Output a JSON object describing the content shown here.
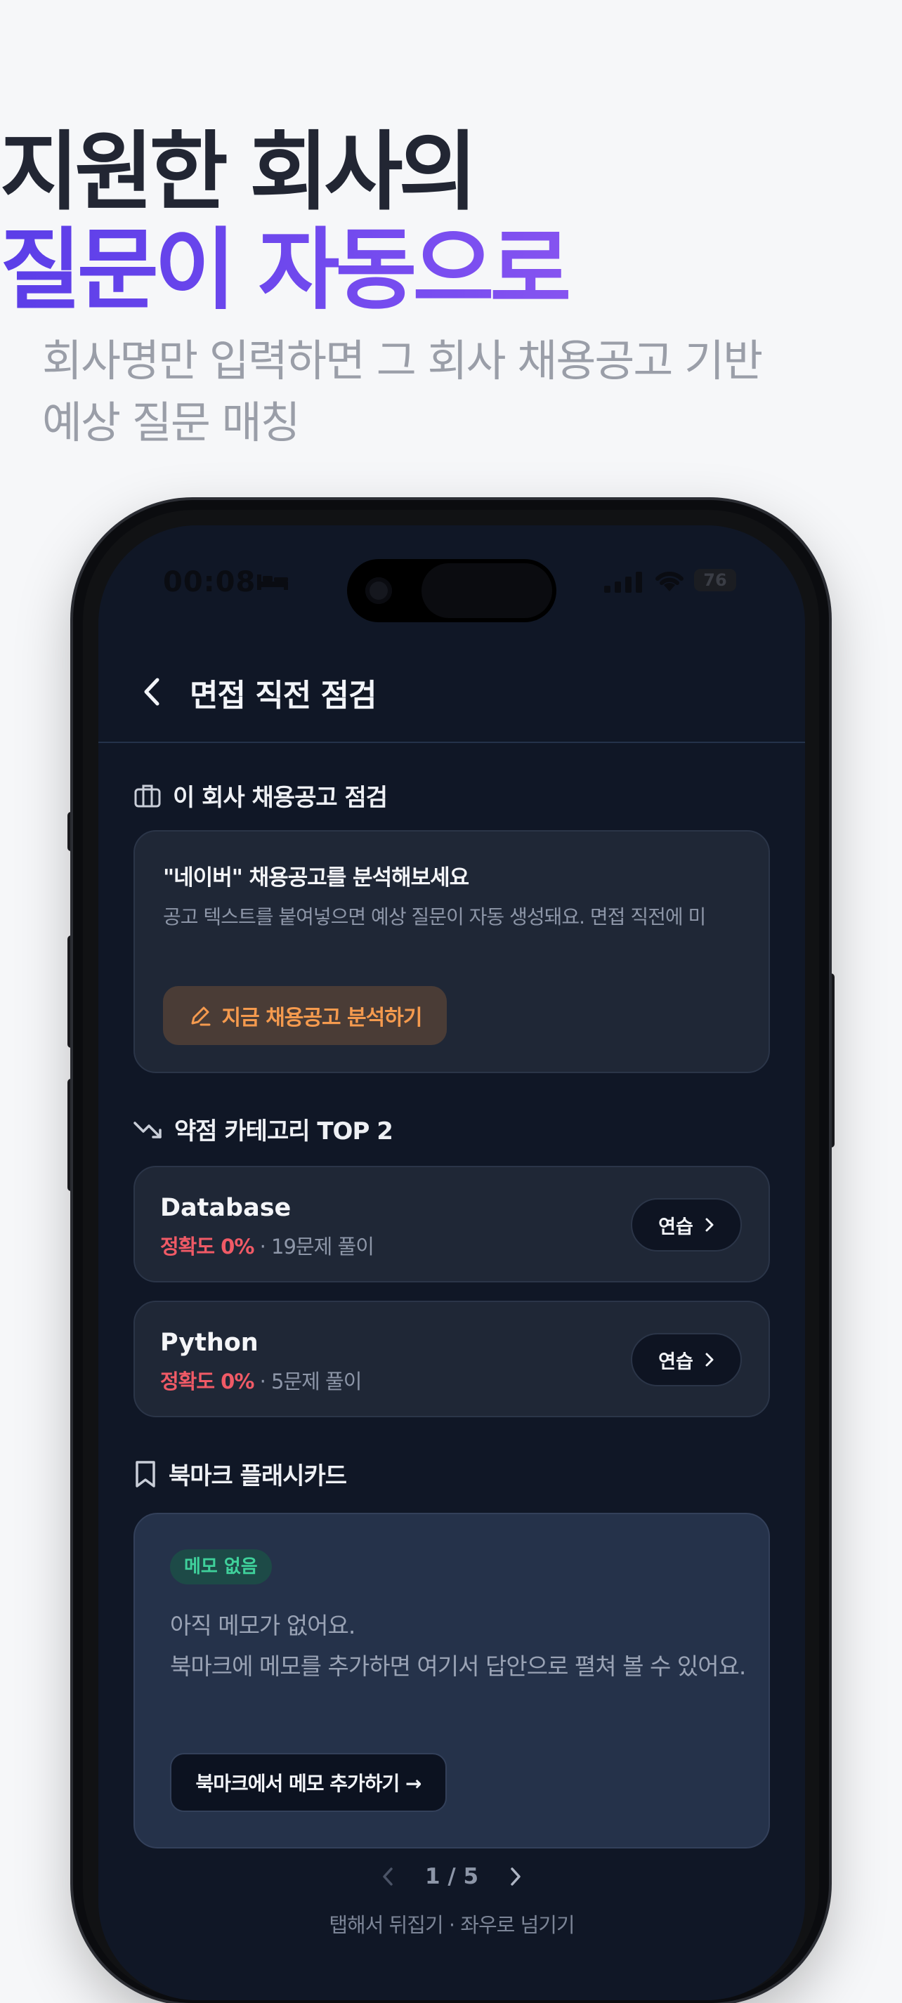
{
  "hero": {
    "title_line1": "지원한 회사의",
    "title_line2": "질문이 자동으로",
    "subtitle_line1": "회사명만 입력하면 그 회사 채용공고 기반",
    "subtitle_line2": "예상 질문 매칭"
  },
  "status_bar": {
    "time": "00:08",
    "battery": "76"
  },
  "nav": {
    "title": "면접 직전 점검"
  },
  "job_section": {
    "heading": "이 회사 채용공고 점검",
    "card_title": "\"네이버\" 채용공고를 분석해보세요",
    "card_desc": "공고 텍스트를 붙여넣으면 예상 질문이 자동 생성돼요. 면접 직전에 미",
    "button_label": "지금 채용공고 분석하기"
  },
  "weak_section": {
    "heading": "약점 카테고리 TOP 2",
    "items": [
      {
        "name": "Database",
        "accuracy": "정확도 0%",
        "count": "· 19문제 풀이",
        "button": "연습"
      },
      {
        "name": "Python",
        "accuracy": "정확도 0%",
        "count": "· 5문제 풀이",
        "button": "연습"
      }
    ]
  },
  "flash_section": {
    "heading": "북마크 플래시카드",
    "badge": "메모 없음",
    "text_line1": "아직 메모가 없어요.",
    "text_line2": "북마크에 메모를 추가하면 여기서 답안으로 펼쳐 볼 수 있어요.",
    "button_label": "북마크에서 메모 추가하기 →",
    "pager": "1 / 5",
    "hint": "탭해서 뒤집기 · 좌우로 넘기기"
  },
  "colors": {
    "accent_orange": "#f59a4e",
    "accent_red": "#f05a66",
    "accent_green": "#3fd19b",
    "gradient": [
      "#5b3ee8",
      "#a863ee"
    ]
  }
}
